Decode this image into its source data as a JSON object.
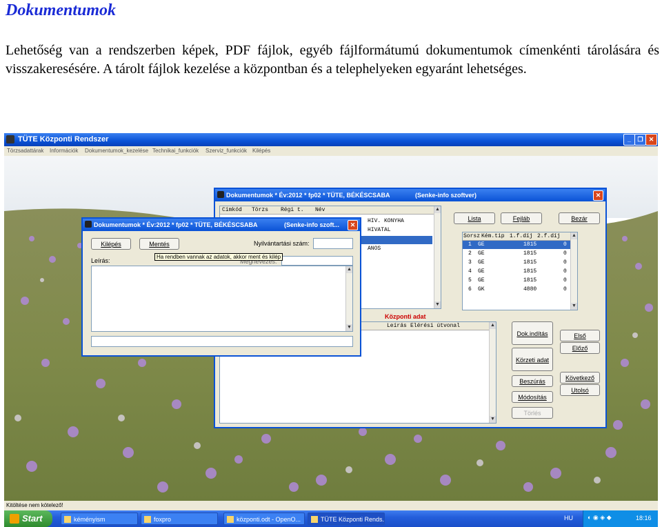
{
  "doc": {
    "title": "Dokumentumok",
    "paragraph": "Lehetőség van a rendszerben képek, PDF fájlok, egyéb fájlformátumú dokumentumok címenkénti tárolására és visszakeresésére. A tárolt fájlok kezelése a központban és a telephelyeken egyaránt lehetséges."
  },
  "app": {
    "title": "TÜTE Központi Rendszer",
    "menu": [
      "Törzsadattárak",
      "Információk",
      "Dokumentumok_kezelése",
      "Technikai_funkciók",
      "Szerviz_funkciók",
      "Kilépés"
    ],
    "window_buttons": [
      "_",
      "❐",
      "✕"
    ],
    "status": "Kitöltése nem kötelező!"
  },
  "main_window": {
    "title": "Dokumentumok * Év:2012 * fp02 * TÜTE, BÉKÉSCSABA",
    "title_right": "(Senke-info szoftver)",
    "list_headers": [
      "Címkód",
      "Törzs",
      "Régi t.",
      "Név"
    ],
    "list_partial": [
      "HIV. KONYHA",
      "HIVATAL",
      "",
      "ANOS"
    ],
    "buttons": {
      "lista": "Lista",
      "fejlab": "Fejláb",
      "bezar": "Bezár"
    },
    "grid_headers": [
      "Sorsz",
      "Kém.tip",
      "1.f.díj",
      "2.f.díj"
    ],
    "grid_rows": [
      [
        "1",
        "GE",
        "1815",
        "0"
      ],
      [
        "2",
        "GE",
        "1815",
        "0"
      ],
      [
        "3",
        "GE",
        "1815",
        "0"
      ],
      [
        "4",
        "GE",
        "1815",
        "0"
      ],
      [
        "5",
        "GE",
        "1815",
        "0"
      ],
      [
        "6",
        "GK",
        "4880",
        "0"
      ]
    ],
    "central_label": "Központi adat",
    "doc_headers": [
      "Leírás",
      "Elérési útvonal"
    ],
    "side_buttons": {
      "dok_inditas": "Dok.indítás",
      "korzeti_adat": "Körzeti adat",
      "beszuras": "Beszúrás",
      "modositas": "Módosítás",
      "torles": "Törlés",
      "elso": "Első",
      "elozo": "Előző",
      "kovetkezo": "Következő",
      "utolso": "Utolsó"
    }
  },
  "dialog": {
    "title": "Dokumentumok * Év:2012 * fp02 * TÜTE, BÉKÉSCSABA",
    "title_right": "(Senke-info szoft...",
    "kilepes": "Kilépés",
    "mentes": "Mentés",
    "nyilv_label": "Nyilvántartási szám:",
    "tooltip": "Ha rendben vannak az adatok, akkor ment és kilép",
    "megnevezes": "Megnevezés:",
    "leiras": "Leírás:"
  },
  "taskbar": {
    "start": "Start",
    "tasks": [
      "kéményism",
      "foxpro",
      "központi.odt - OpenO...",
      "TÜTE Központi Rends..."
    ],
    "lang": "HU",
    "time": "18:16"
  }
}
